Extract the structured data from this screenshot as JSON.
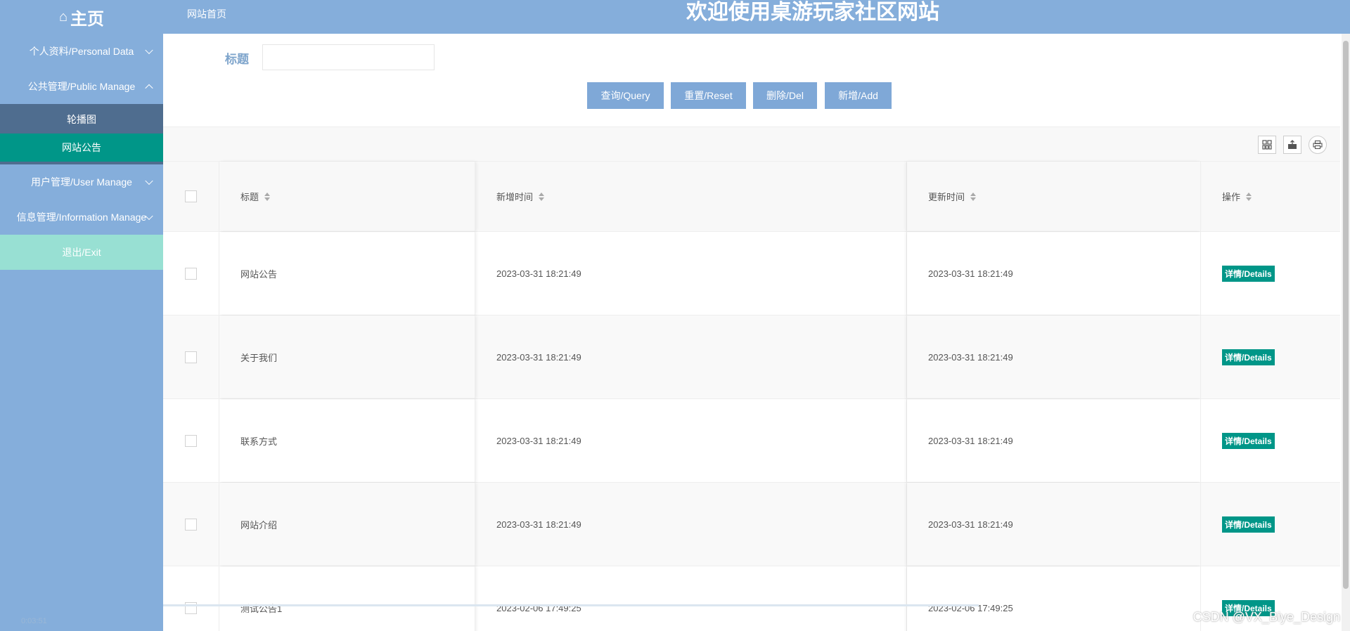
{
  "header": {
    "home_label": "主页",
    "breadcrumb": "网站首页",
    "site_title": "欢迎使用桌游玩家社区网站"
  },
  "sidebar": {
    "items": [
      {
        "label": "个人资料/Personal Data",
        "expanded": false
      },
      {
        "label": "公共管理/Public Manage",
        "expanded": true,
        "children": [
          {
            "label": "轮播图",
            "active": false
          },
          {
            "label": "网站公告",
            "active": true
          }
        ]
      },
      {
        "label": "用户管理/User Manage",
        "expanded": false
      },
      {
        "label": "信息管理/Information Manage",
        "expanded": false
      }
    ],
    "exit_label": "退出/Exit",
    "timer": "0:03:51"
  },
  "search": {
    "label": "标题",
    "value": "",
    "placeholder": ""
  },
  "buttons": {
    "query": "查询/Query",
    "reset": "重置/Reset",
    "delete": "删除/Del",
    "add": "新增/Add"
  },
  "toolbar_icons": [
    "columns-icon",
    "export-icon",
    "print-icon"
  ],
  "table": {
    "headers": {
      "title": "标题",
      "created": "新增时间",
      "updated": "更新时间",
      "action": "操作"
    },
    "rows": [
      {
        "title": "网站公告",
        "created": "2023-03-31 18:21:49",
        "updated": "2023-03-31 18:21:49",
        "action": "详情/Details"
      },
      {
        "title": "关于我们",
        "created": "2023-03-31 18:21:49",
        "updated": "2023-03-31 18:21:49",
        "action": "详情/Details"
      },
      {
        "title": "联系方式",
        "created": "2023-03-31 18:21:49",
        "updated": "2023-03-31 18:21:49",
        "action": "详情/Details"
      },
      {
        "title": "网站介绍",
        "created": "2023-03-31 18:21:49",
        "updated": "2023-03-31 18:21:49",
        "action": "详情/Details"
      },
      {
        "title": "测试公告1",
        "created": "2023-02-06 17:49:25",
        "updated": "2023-02-06 17:49:25",
        "action": "详情/Details"
      }
    ]
  },
  "watermark": "CSDN @VX_Biye_Design",
  "colors": {
    "header_bg": "#85aedb",
    "active_green": "#009688",
    "exit_bg": "#98e0d3",
    "button_bg": "#7fa8d7"
  }
}
